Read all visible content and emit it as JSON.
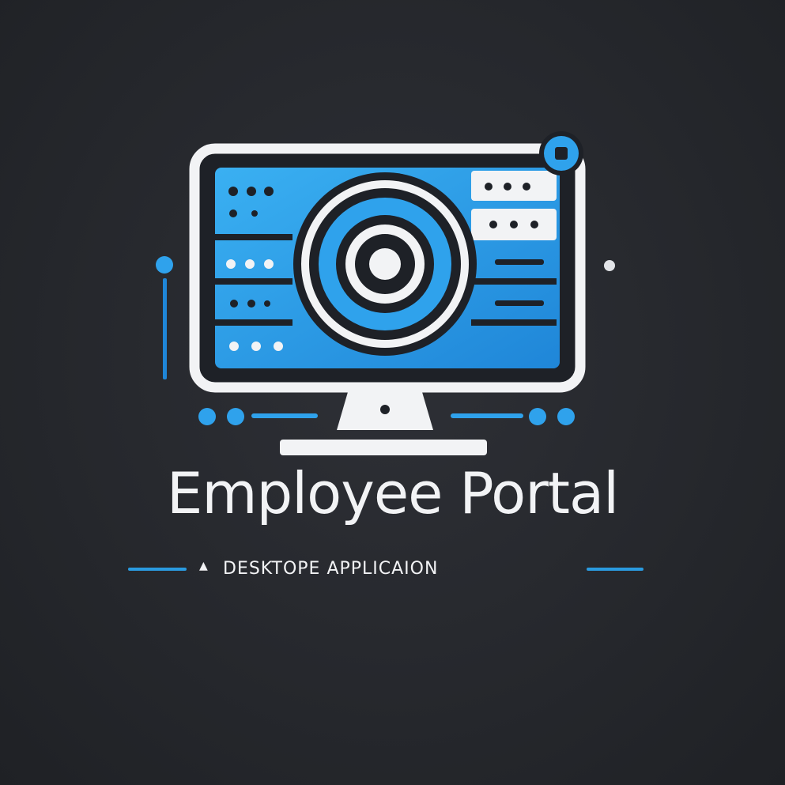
{
  "brand": {
    "title": "Employee Portal",
    "subtitle": "DESKTOPE APPLICAION",
    "subtitle_mark": "▲"
  },
  "colors": {
    "background": "#26282d",
    "accent_blue": "#2a9be0",
    "light_blue": "#4fb8f5",
    "white": "#f2f3f5",
    "dark": "#1e2127"
  },
  "icons": {
    "logo": "monitor-target-icon"
  }
}
